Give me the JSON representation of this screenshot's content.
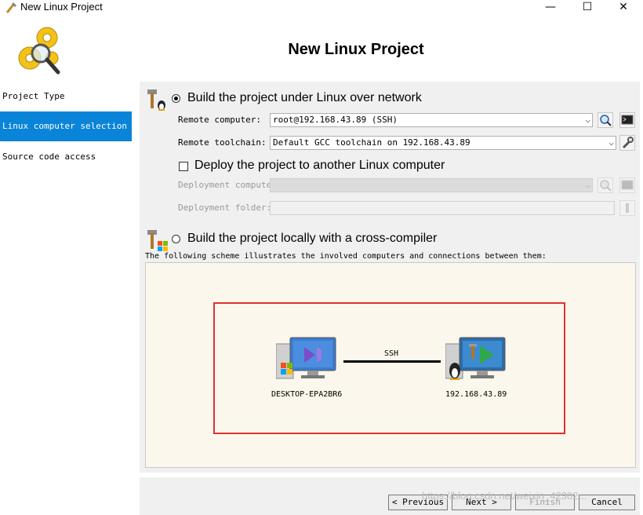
{
  "window": {
    "title": "New Linux Project",
    "minimize": "—",
    "maximize": "☐",
    "close": "✕"
  },
  "header": {
    "title": "New Linux Project"
  },
  "sidebar": {
    "items": [
      {
        "label": "Project Type",
        "active": false
      },
      {
        "label": "Linux computer selection",
        "active": true
      },
      {
        "label": "Source code access",
        "active": false
      }
    ]
  },
  "network": {
    "option_label": "Build the project under Linux over network",
    "selected": true,
    "remote_computer_label": "Remote computer:",
    "remote_computer_value": "root@192.168.43.89 (SSH)",
    "remote_toolchain_label": "Remote toolchain:",
    "remote_toolchain_value": "Default GCC toolchain on 192.168.43.89",
    "deploy_label": "Deploy the project to another Linux computer",
    "deploy_checked": false,
    "deployment_computer_label": "Deployment computer:",
    "deployment_folder_label": "Deployment folder:"
  },
  "local": {
    "option_label": "Build the project locally with a cross-compiler",
    "selected": false
  },
  "scheme": {
    "caption": "The following scheme illustrates the involved computers and connections between them:",
    "left_node": "DESKTOP-EPA2BR6",
    "right_node": "192.168.43.89",
    "connection": "SSH"
  },
  "buttons": {
    "previous": "< Previous",
    "next": "Next >",
    "finish": "Finish",
    "cancel": "Cancel"
  },
  "watermark": "https://blog.csdn.net/weixin_42302..."
}
